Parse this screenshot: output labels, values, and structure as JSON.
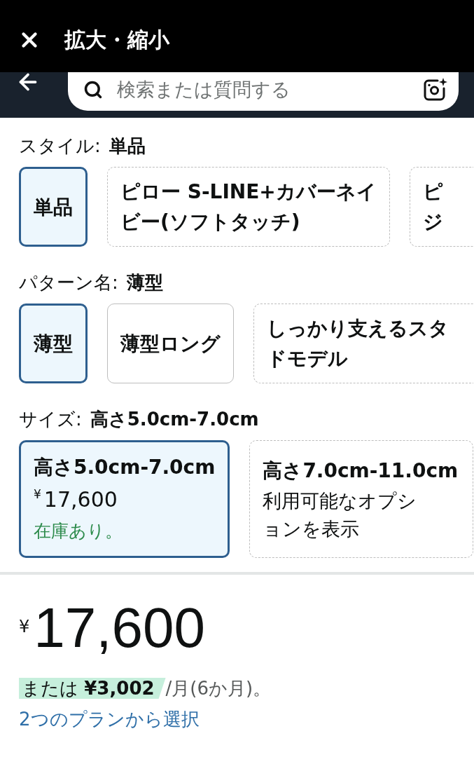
{
  "top_bar": {
    "title": "拡大・縮小"
  },
  "search": {
    "placeholder": "検索または質問する"
  },
  "variations": [
    {
      "name": "スタイル:",
      "value": "単品",
      "options": [
        {
          "lines": [
            "単品"
          ],
          "selected": true,
          "available": true,
          "cut_off": false
        },
        {
          "lines": [
            "ピロー S-LINE+カバーネイ",
            "ビー(ソフトタッチ)"
          ],
          "selected": false,
          "available": false,
          "cut_off": false
        },
        {
          "lines": [
            "ピ",
            "ジ"
          ],
          "selected": false,
          "available": false,
          "cut_off": true
        }
      ]
    },
    {
      "name": "パターン名:",
      "value": "薄型",
      "options": [
        {
          "lines": [
            "薄型"
          ],
          "selected": true,
          "available": true,
          "cut_off": false
        },
        {
          "lines": [
            "薄型ロング"
          ],
          "selected": false,
          "available": true,
          "cut_off": false
        },
        {
          "lines": [
            "しっかり支えるスタ",
            "ドモデル"
          ],
          "selected": false,
          "available": false,
          "cut_off": true
        }
      ]
    },
    {
      "name": "サイズ:",
      "value": "高さ5.0cm-7.0cm",
      "options": [
        {
          "lines": [
            "高さ5.0cm-7.0cm"
          ],
          "selected": true,
          "available": true,
          "cut_off": false,
          "currency": "¥",
          "price": "17,600",
          "stock": "在庫あり。"
        },
        {
          "lines": [
            "高さ7.0cm-11.0cm"
          ],
          "selected": false,
          "available": false,
          "cut_off": false,
          "note_lines": [
            "利用可能なオプシ",
            "ョンを表示"
          ]
        }
      ]
    }
  ],
  "price": {
    "currency": "¥",
    "amount": "17,600"
  },
  "installment": {
    "prefix": "または",
    "amount": "¥3,002",
    "suffix": "/月(6か月)。"
  },
  "plans_link": "2つのプランから選択"
}
